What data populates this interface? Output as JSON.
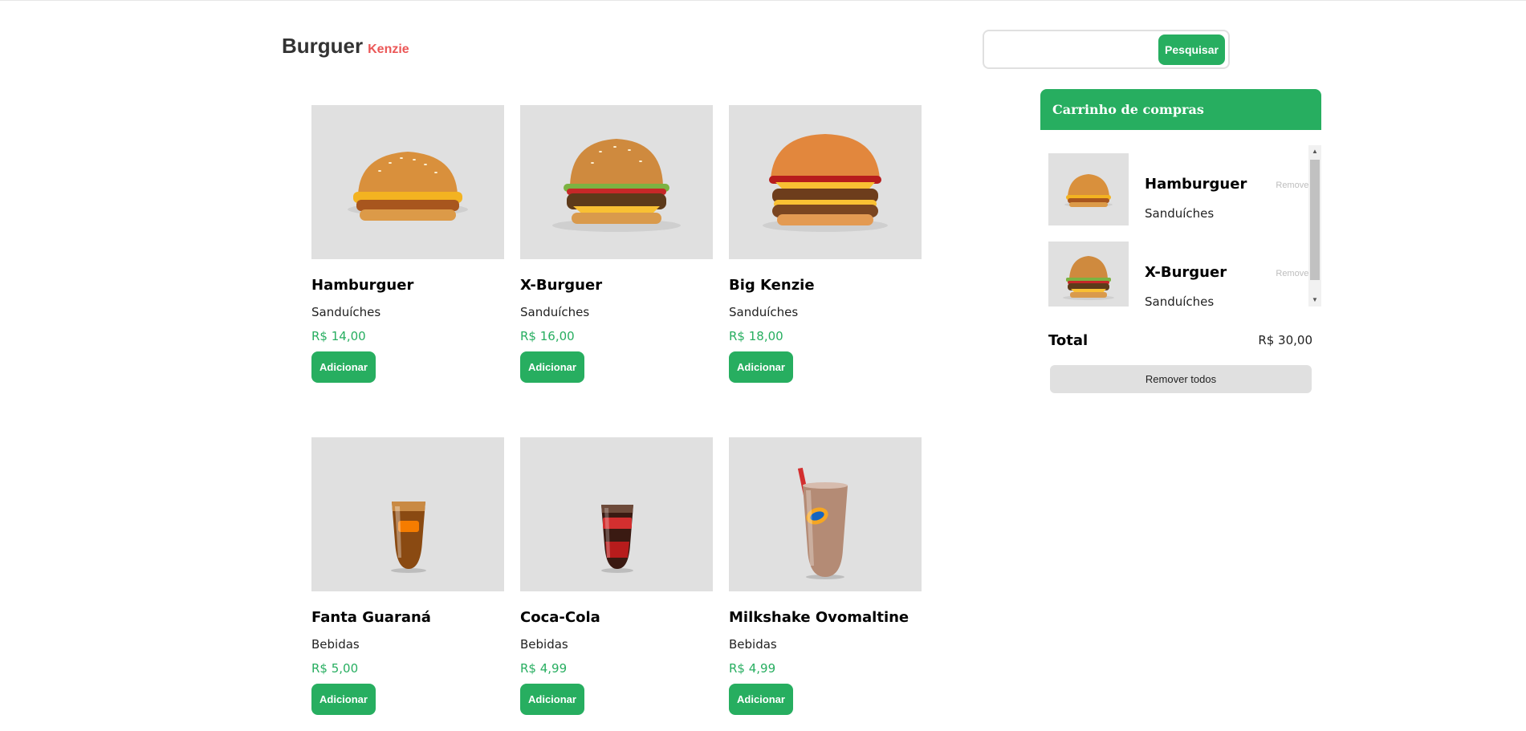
{
  "header": {
    "logo_main": "Burguer",
    "logo_sub": "Kenzie",
    "search_value": "",
    "search_button": "Pesquisar"
  },
  "products": [
    {
      "name": "Hamburguer",
      "category": "Sanduíches",
      "price": "R$ 14,00",
      "button": "Adicionar",
      "icon": "burger-chicken"
    },
    {
      "name": "X-Burguer",
      "category": "Sanduíches",
      "price": "R$ 16,00",
      "button": "Adicionar",
      "icon": "burger-cheese"
    },
    {
      "name": "Big Kenzie",
      "category": "Sanduíches",
      "price": "R$ 18,00",
      "button": "Adicionar",
      "icon": "burger-big"
    },
    {
      "name": "Fanta Guaraná",
      "category": "Bebidas",
      "price": "R$ 5,00",
      "button": "Adicionar",
      "icon": "soda-fanta"
    },
    {
      "name": "Coca-Cola",
      "category": "Bebidas",
      "price": "R$ 4,99",
      "button": "Adicionar",
      "icon": "soda-cola"
    },
    {
      "name": "Milkshake Ovomaltine",
      "category": "Bebidas",
      "price": "R$ 4,99",
      "button": "Adicionar",
      "icon": "milkshake"
    }
  ],
  "cart": {
    "title": "Carrinho de compras",
    "items": [
      {
        "name": "Hamburguer",
        "category": "Sanduíches",
        "remove": "Remover"
      },
      {
        "name": "X-Burguer",
        "category": "Sanduíches",
        "remove": "Remover"
      }
    ],
    "total_label": "Total",
    "total_value": "R$ 30,00",
    "remove_all": "Remover todos"
  },
  "colors": {
    "primary": "#27ae60",
    "secondary": "#eb5757",
    "gray_bg": "#e0e0e0"
  }
}
